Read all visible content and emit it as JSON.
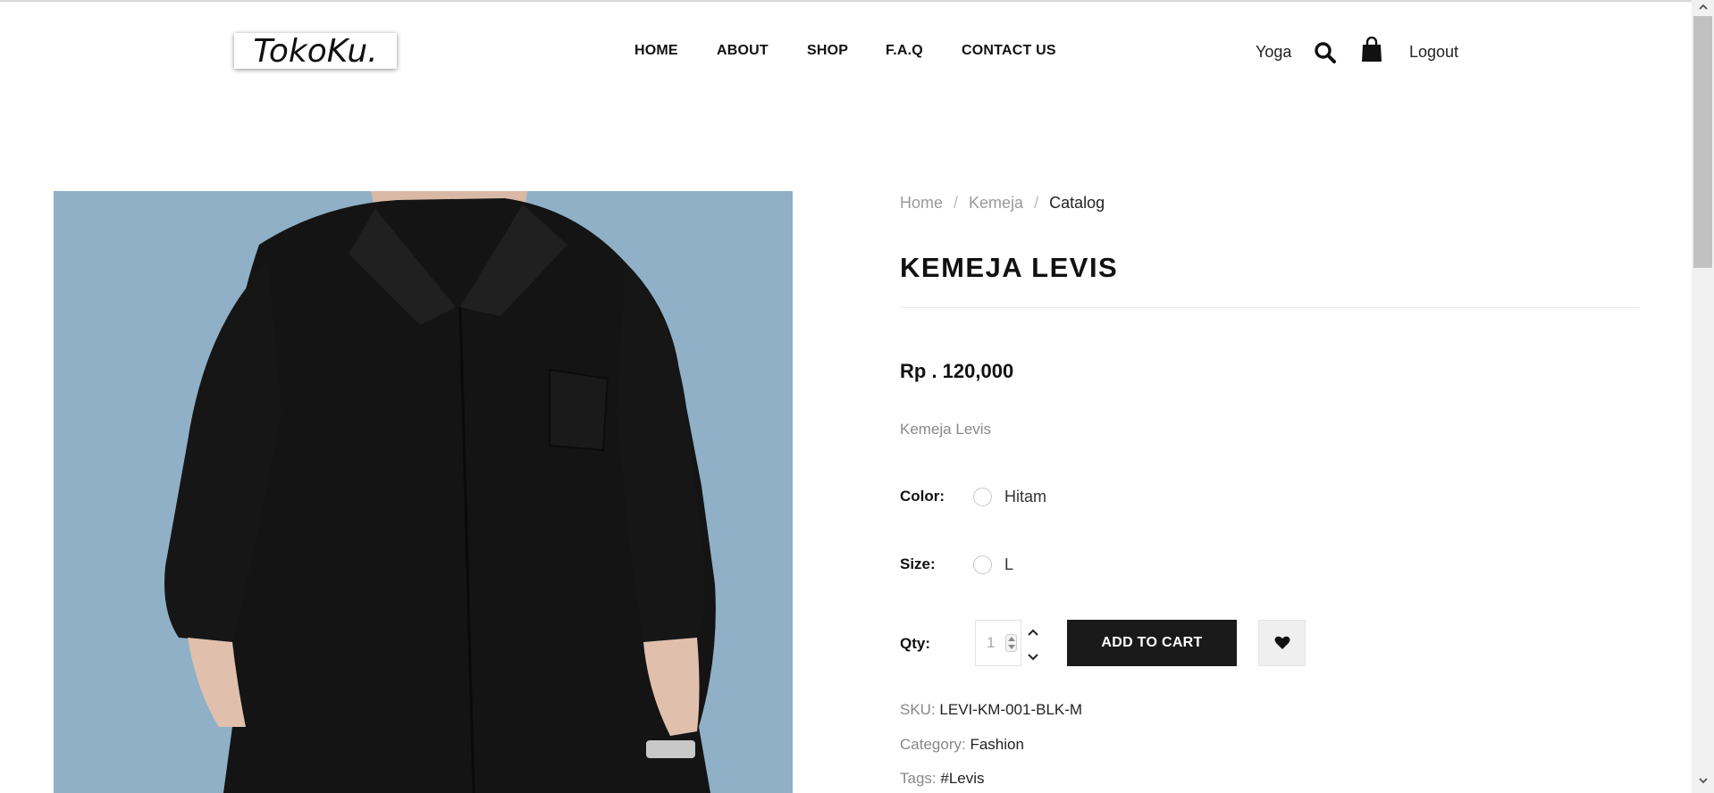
{
  "header": {
    "logo": "TokoKu.",
    "nav": [
      {
        "label": "HOME"
      },
      {
        "label": "ABOUT"
      },
      {
        "label": "SHOP"
      },
      {
        "label": "F.A.Q"
      },
      {
        "label": "CONTACT US"
      }
    ],
    "user_name": "Yoga",
    "logout_label": "Logout",
    "icons": {
      "search": "search-icon",
      "cart": "shopping-bag-icon"
    }
  },
  "breadcrumb": [
    {
      "label": "Home"
    },
    {
      "label": "Kemeja"
    },
    {
      "label": "Catalog"
    }
  ],
  "breadcrumb_separator": "/",
  "product": {
    "title": "KEMEJA LEVIS",
    "price": "Rp . 120,000",
    "description": "Kemeja Levis",
    "color_label": "Color:",
    "color_option": "Hitam",
    "size_label": "Size:",
    "size_option": "L",
    "qty_label": "Qty:",
    "qty_value": "1",
    "add_to_cart_label": "ADD TO CART",
    "wishlist_icon": "heart-icon",
    "sku_label": "SKU:",
    "sku_value": "LEVI-KM-001-BLK-M",
    "category_label": "Category:",
    "category_value": "Fashion",
    "tags_label": "Tags:",
    "tags_value": "#Levis",
    "image_colors": {
      "background": "#8fb0c6",
      "shirt": "#141414"
    }
  }
}
